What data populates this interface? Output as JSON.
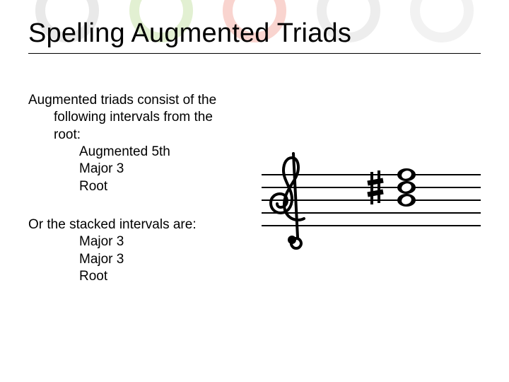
{
  "title": "Spelling Augmented Triads",
  "intro": {
    "lead": "Augmented triads consist of the following intervals from the root:",
    "items": [
      "Augmented 5th",
      "Major 3",
      "Root"
    ]
  },
  "stacked": {
    "lead": "Or the stacked intervals are:",
    "items": [
      "Major 3",
      "Major 3",
      "Root"
    ]
  },
  "music": {
    "description": "treble-clef staff with a three-note chord preceded by a sharp accidental"
  }
}
